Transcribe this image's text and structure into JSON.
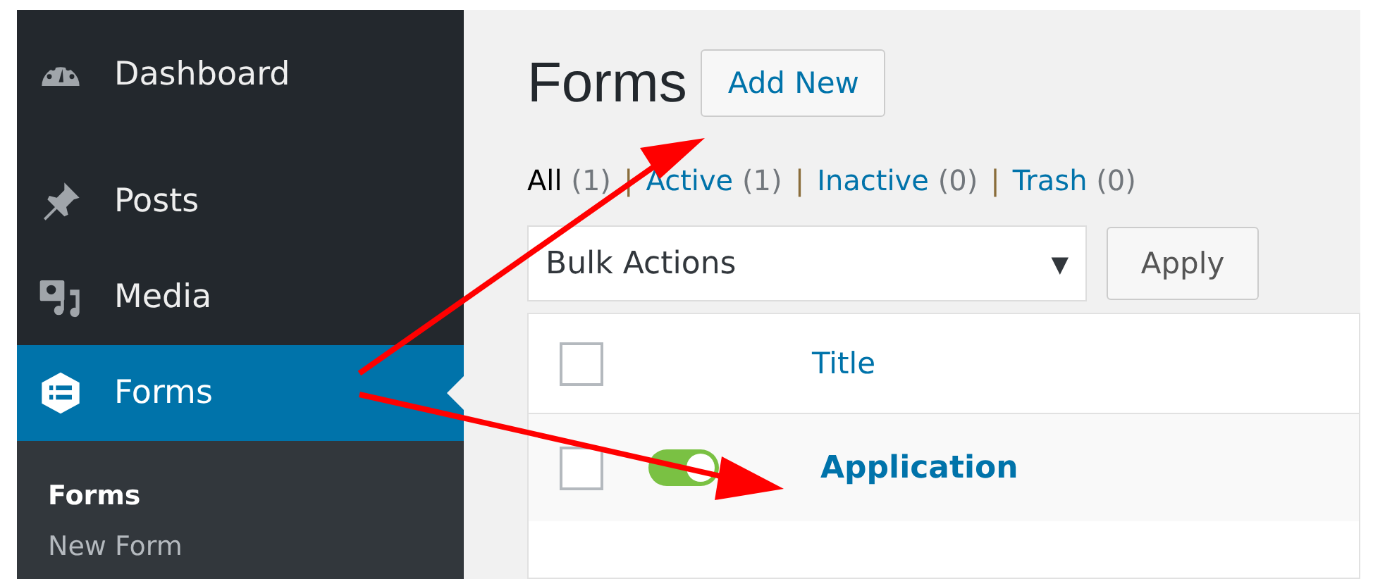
{
  "sidebar": {
    "items": [
      {
        "label": "Dashboard",
        "selected": false
      },
      {
        "label": "Posts",
        "selected": false
      },
      {
        "label": "Media",
        "selected": false
      },
      {
        "label": "Forms",
        "selected": true
      }
    ],
    "submenu": [
      {
        "label": "Forms",
        "selected": true
      },
      {
        "label": "New Form",
        "selected": false
      }
    ]
  },
  "page": {
    "title": "Forms",
    "add_button": "Add New"
  },
  "filters": [
    {
      "label": "All",
      "count": "(1)",
      "selected": true
    },
    {
      "separator": "|",
      "label": "Active",
      "count": "(1)",
      "selected": false
    },
    {
      "separator": "|",
      "label": "Inactive",
      "count": "(0)",
      "selected": false
    },
    {
      "separator": "|",
      "label": "Trash",
      "count": "(0)",
      "selected": false
    }
  ],
  "bulk": {
    "value": "Bulk Actions",
    "caret": "▼",
    "apply": "Apply"
  },
  "table": {
    "columns": [
      "Title"
    ],
    "rows": [
      {
        "title": "Application",
        "checked": false,
        "on": true
      }
    ],
    "header_checked": false
  }
}
